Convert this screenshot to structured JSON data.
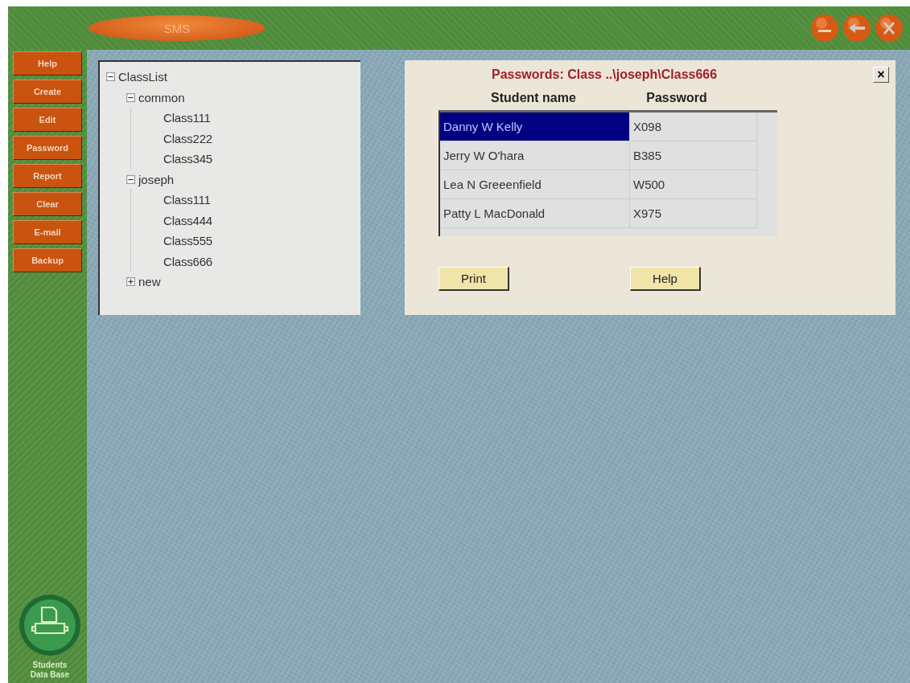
{
  "window": {
    "title": "SMS"
  },
  "sidebar": {
    "buttons": [
      "Help",
      "Create",
      "Edit",
      "Password",
      "Report",
      "Clear",
      "E-mail",
      "Backup"
    ],
    "logo_caption": "Students Data Base"
  },
  "tree": [
    {
      "label": "ClassList",
      "expanded": true,
      "children": [
        {
          "label": "common",
          "expanded": true,
          "children": [
            {
              "label": "Class111"
            },
            {
              "label": "Class222"
            },
            {
              "label": "Class345"
            }
          ]
        },
        {
          "label": "joseph",
          "expanded": true,
          "children": [
            {
              "label": "Class111"
            },
            {
              "label": "Class444"
            },
            {
              "label": "Class555"
            },
            {
              "label": "Class666"
            }
          ]
        },
        {
          "label": "new",
          "expanded": false
        }
      ]
    }
  ],
  "dialog": {
    "title": "Passwords: Class ..\\joseph\\Class666",
    "close": "×",
    "columns": [
      "Student name",
      "Password"
    ],
    "rows": [
      {
        "name": "Danny W Kelly",
        "password": "X098",
        "selected": true
      },
      {
        "name": "Jerry W O'hara",
        "password": "B385",
        "selected": false
      },
      {
        "name": "Lea N Greeenfield",
        "password": "W500",
        "selected": false
      },
      {
        "name": "Patty L MacDonald",
        "password": "X975",
        "selected": false
      }
    ],
    "buttons": [
      "Print",
      "Help"
    ]
  }
}
